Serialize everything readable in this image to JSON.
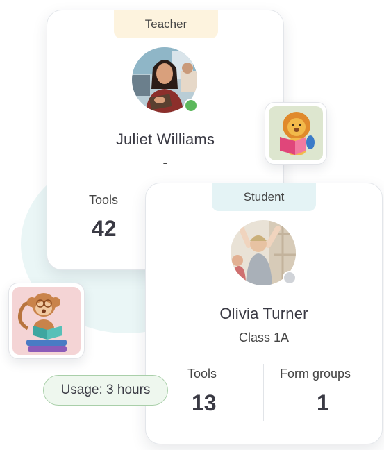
{
  "teacher": {
    "role": "Teacher",
    "name": "Juliet Williams",
    "subtitle": "-",
    "stat_label": "Tools",
    "stat_value": "42",
    "status_color": "#5cb85c"
  },
  "student": {
    "role": "Student",
    "name": "Olivia Turner",
    "subtitle": "Class 1A",
    "stats": [
      {
        "label": "Tools",
        "value": "13"
      },
      {
        "label": "Form groups",
        "value": "1"
      }
    ],
    "status_color": "#d0d3d8"
  },
  "usage": {
    "label": "Usage: 3 hours"
  },
  "stickers": [
    {
      "icon": "lion-reading-icon"
    },
    {
      "icon": "monkey-reading-icon"
    }
  ]
}
